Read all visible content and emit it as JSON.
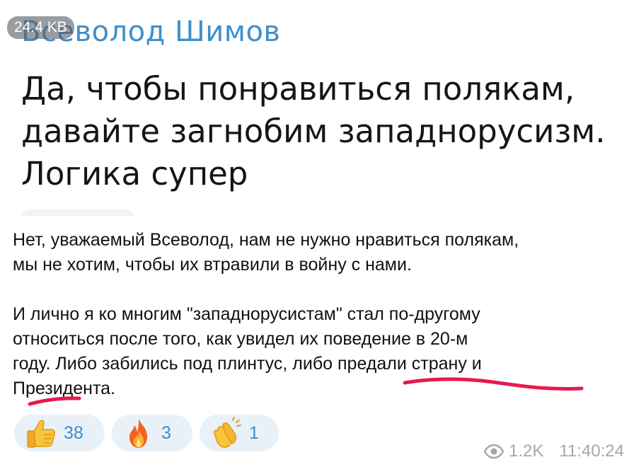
{
  "embedded": {
    "author": "Всеволод Шимов",
    "text": "Да, чтобы понравиться полякам,\nдавайте загнобим западнорусизм.\nЛогика супер",
    "size_badge": "24.4 KB"
  },
  "caption": {
    "paragraph1": "Нет, уважаемый Всеволод, нам не нужно нравиться полякам,\nмы не хотим, чтобы их втравили в войну с нами.",
    "paragraph2": "И лично я ко многим \"западнорусистам\" стал по-другому\nотноситься после того, как увидел их поведение в 20-м\nгоду. Либо забились под плинтус, либо предали страну и\nПрезидента."
  },
  "reactions": [
    {
      "emoji": "thumbs-up",
      "count": "38"
    },
    {
      "emoji": "fire",
      "count": "3"
    },
    {
      "emoji": "clapping-hands",
      "count": "1"
    }
  ],
  "meta": {
    "views": "1.2K",
    "time": "11:40:24"
  },
  "colors": {
    "author": "#3d8fcd",
    "reaction_bg": "#e9f1f8",
    "reaction_count": "#3a8fd0",
    "meta": "#a3a8ad",
    "annotation": "#e8184e"
  }
}
